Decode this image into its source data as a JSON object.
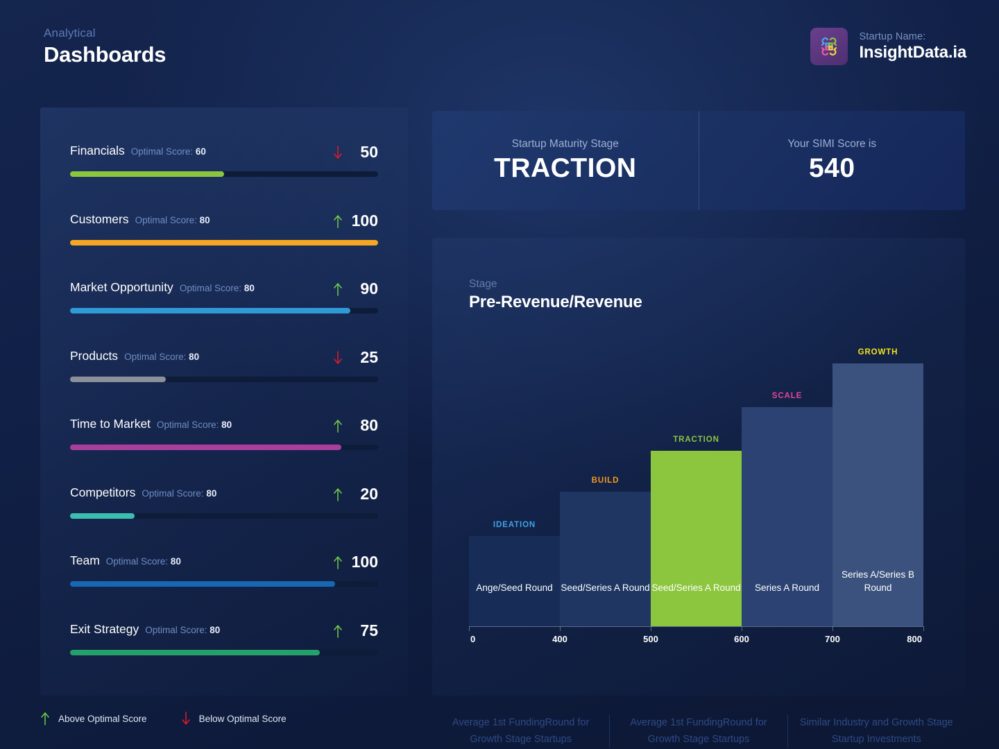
{
  "header": {
    "eyebrow": "Analytical",
    "title": "Dashboards",
    "brand_label": "Startup Name:",
    "brand_name": "InsightData.ia",
    "logo_icon": "interlocking-loops-logo-icon"
  },
  "metrics": {
    "optimal_prefix": "Optimal Score:",
    "items": [
      {
        "name": "Financials",
        "optimal": "60",
        "score": "50",
        "direction": "down",
        "fill_pct": 50,
        "color": "#8cc63f"
      },
      {
        "name": "Customers",
        "optimal": "80",
        "score": "100",
        "direction": "up",
        "fill_pct": 100,
        "color": "#f5a623"
      },
      {
        "name": "Market Opportunity",
        "optimal": "80",
        "score": "90",
        "direction": "up",
        "fill_pct": 91,
        "color": "#2e9bd6"
      },
      {
        "name": "Products",
        "optimal": "80",
        "score": "25",
        "direction": "down",
        "fill_pct": 31,
        "color": "#8b9099"
      },
      {
        "name": "Time to Market",
        "optimal": "80",
        "score": "80",
        "direction": "up",
        "fill_pct": 88,
        "color": "#a93f9c"
      },
      {
        "name": "Competitors",
        "optimal": "80",
        "score": "20",
        "direction": "up",
        "fill_pct": 21,
        "color": "#3dbdb0"
      },
      {
        "name": "Team",
        "optimal": "80",
        "score": "100",
        "direction": "up",
        "fill_pct": 86,
        "color": "#1668b3"
      },
      {
        "name": "Exit Strategy",
        "optimal": "80",
        "score": "75",
        "direction": "up",
        "fill_pct": 81,
        "color": "#25a06a"
      }
    ]
  },
  "legend": {
    "above_label": "Above Optimal Score",
    "below_label": "Below Optimal Score",
    "up_icon": "arrow-up-icon",
    "down_icon": "arrow-down-icon",
    "up_color": "#6fcf45",
    "down_color": "#e3192b"
  },
  "stats": [
    {
      "label": "Startup Maturity Stage",
      "value": "TRACTION"
    },
    {
      "label": "Your SIMI Score is",
      "value": "540"
    }
  ],
  "chart_header": {
    "eyebrow": "Stage",
    "title": "Pre-Revenue/Revenue"
  },
  "chart_data": {
    "type": "bar",
    "title": "Pre-Revenue/Revenue",
    "xlabel": "",
    "ylabel": "",
    "grid": false,
    "legend": "above-bars",
    "xlim": [
      0,
      800
    ],
    "xticks": [
      "0",
      "400",
      "500",
      "600",
      "700",
      "800"
    ],
    "categories": [
      "Ange/Seed Round",
      "Seed/Series A Round",
      "Seed/Series A Round",
      "Series A Round",
      "Series A/Series B Round"
    ],
    "stage_tags": [
      "IDEATION",
      "BUILD",
      "TRACTION",
      "SCALE",
      "GROWTH"
    ],
    "stage_tag_colors": [
      "#3fa3e8",
      "#f59b1c",
      "#8cc63f",
      "#e0479e",
      "#f4e11a"
    ],
    "values": [
      130,
      193,
      254,
      316,
      378
    ],
    "value_unit": "px-height",
    "heights_pct": [
      33,
      49,
      64,
      80,
      96
    ],
    "bar_colors": [
      "#172d58",
      "#1f3663",
      "#8cc63f",
      "#2b4273",
      "#3b527e"
    ],
    "highlight_index": 2,
    "highlight_label": "TRACTION"
  },
  "footer": {
    "items": [
      "Average 1st FundingRound for Growth Stage Startups",
      "Average 1st FundingRound for Growth Stage Startups",
      "Similar Industry and Growth Stage Startup Investments"
    ]
  }
}
